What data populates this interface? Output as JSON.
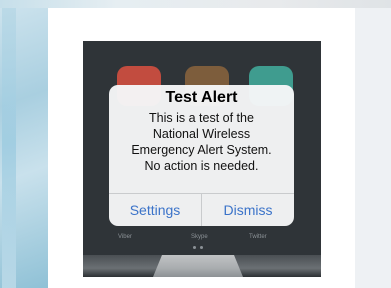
{
  "alert": {
    "title": "Test Alert",
    "message_lines": [
      "This is a test of the",
      "National Wireless",
      "Emergency Alert System.",
      "No action is needed."
    ],
    "buttons": [
      "Settings",
      "Dismiss"
    ]
  },
  "dock": {
    "labels": [
      "Viber",
      "Skype",
      "Twitter"
    ]
  },
  "colors": {
    "button_text": "#3b73c9",
    "alert_background": "#f5f6f7",
    "phone_background": "#2f3438"
  }
}
